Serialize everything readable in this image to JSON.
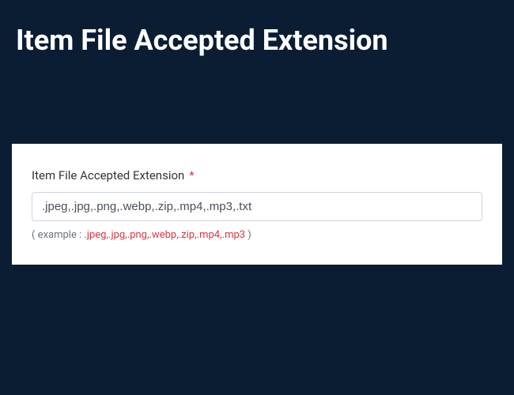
{
  "header": {
    "title": "Item File Accepted Extension"
  },
  "form": {
    "extension_field": {
      "label": "Item File Accepted Extension",
      "required_mark": "*",
      "value": ".jpeg,.jpg,.png,.webp,.zip,.mp4,.mp3,.txt",
      "helper_prefix": "( example : ",
      "helper_example": ".jpeg,.jpg,.png,.webp,.zip,.mp4,.mp3",
      "helper_suffix": " )"
    }
  }
}
